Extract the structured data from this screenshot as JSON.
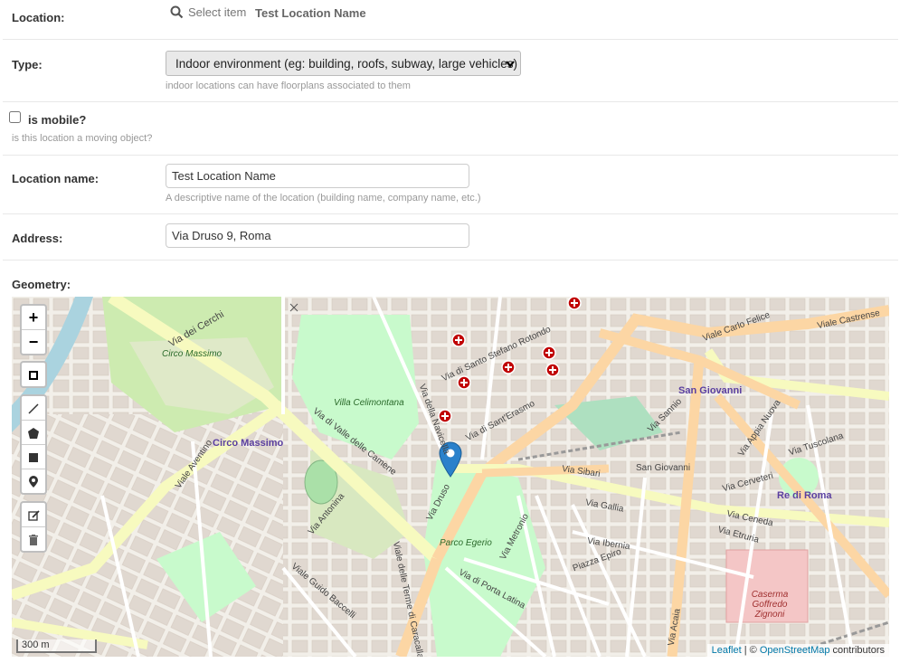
{
  "location": {
    "label": "Location:",
    "select_placeholder": "Select item",
    "value": "Test Location Name"
  },
  "type": {
    "label": "Type:",
    "selected": "Indoor environment (eg: building, roofs, subway, large vehicles)",
    "help": "indoor locations can have floorplans associated to them"
  },
  "is_mobile": {
    "label": "is mobile?",
    "help": "is this location a moving object?"
  },
  "location_name": {
    "label": "Location name:",
    "value": "Test Location Name",
    "help": "A descriptive name of the location (building name, company name, etc.)"
  },
  "address": {
    "label": "Address:",
    "value": "Via Druso 9, Roma"
  },
  "geometry": {
    "label": "Geometry:"
  },
  "map": {
    "zoom_in": "+",
    "zoom_out": "−",
    "scale": "300 m",
    "attribution": {
      "leaflet": "Leaflet",
      "sep": " | © ",
      "osm": "OpenStreetMap",
      "suffix": " contributors"
    },
    "labels": {
      "circo_massimo_1": "Circo Massimo",
      "circo_massimo_2": "Circo Massimo",
      "villa": "Villa Celimontana",
      "san_giovanni_1": "San Giovanni",
      "san_giovanni_2": "San Giovanni",
      "re_di_roma": "Re di Roma",
      "parco_egerio": "Parco Egerio",
      "caserma": "Caserma Goffredo Zignoni",
      "via_druso": "Via Druso",
      "viale_aventino": "Viale Aventino",
      "via_dei_cerchi": "Via dei Cerchi",
      "via_gallia": "Via Gallia",
      "viale_appia_nuova": "Via Appia Nuova",
      "via_cerveteri": "Via Cerveteri",
      "viale_castrense": "Viale Castrense",
      "via_della_navicella": "Via della Navicella",
      "viale_terme_caracalla": "Viale delle Terme di Caracalla",
      "via_porta_latina": "Via di Porta Latina",
      "piazza_epiro": "Piazza Epiro",
      "via_ibernia": "Via Ibernia",
      "viale_guido_baccelli": "Viale Guido Baccelli",
      "via_antonina": "Via Antonina",
      "viale_carlo_felice": "Viale Carlo Felice",
      "via_tuscolana": "Via Tuscolana",
      "via_acaia": "Via Acaia",
      "via_etruria": "Via Etruria",
      "via_ceneda": "Via Ceneda",
      "via_sannio": "Via Sannio",
      "via_sibari": "Via Sibari",
      "via_camene": "Via di Valle delle Camene",
      "via_santo_stefano": "Via di Santo Stefano Rotondo",
      "via_san_erasmo": "Via di Sant'Erasmo",
      "via_metronio": "Via Metronio"
    }
  },
  "colors": {
    "water": "#aad3df",
    "park": "#c8facc",
    "road_major": "#fcd6a4",
    "road_trunk": "#f7fabf",
    "marker": "#2a81cb"
  }
}
